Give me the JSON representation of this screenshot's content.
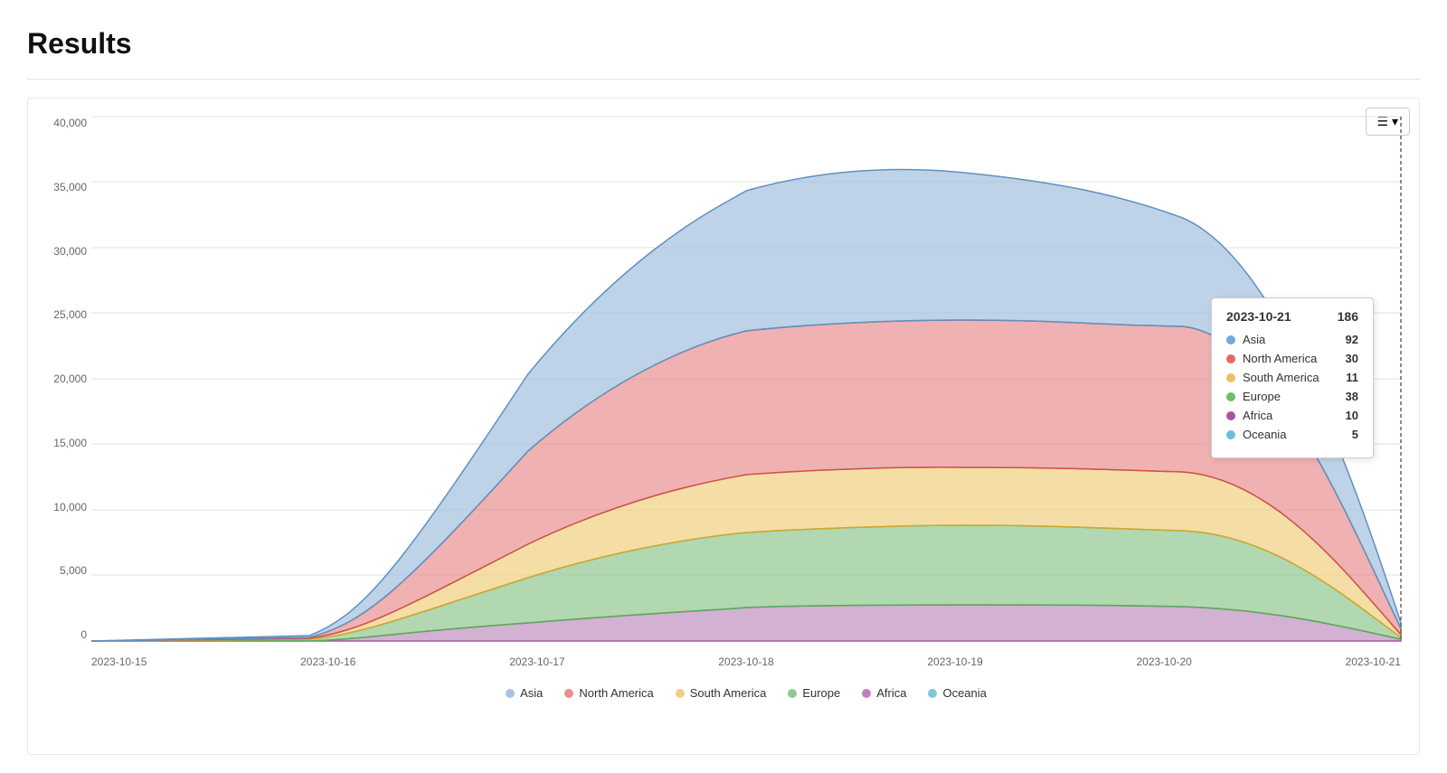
{
  "page": {
    "title": "Results"
  },
  "chart": {
    "menu_label": "☰ ▾",
    "y_axis_labels": [
      "0",
      "5,000",
      "10,000",
      "15,000",
      "20,000",
      "25,000",
      "30,000",
      "35,000",
      "40,000"
    ],
    "x_axis_labels": [
      "2023-10-15",
      "2023-10-16",
      "2023-10-17",
      "2023-10-18",
      "2023-10-19",
      "2023-10-20",
      "2023-10-21"
    ]
  },
  "tooltip": {
    "date": "2023-10-21",
    "total": "186",
    "rows": [
      {
        "region": "Asia",
        "color": "#6fa8dc",
        "value": "92"
      },
      {
        "region": "North America",
        "color": "#e06c5c",
        "value": "30"
      },
      {
        "region": "South America",
        "color": "#f0c060",
        "value": "11"
      },
      {
        "region": "Europe",
        "color": "#6abf69",
        "value": "38"
      },
      {
        "region": "Africa",
        "color": "#a855a0",
        "value": "10"
      },
      {
        "region": "Oceania",
        "color": "#6bbfd9",
        "value": "5"
      }
    ]
  },
  "legend": {
    "items": [
      {
        "label": "Asia",
        "color": "#a8c4e0"
      },
      {
        "label": "North America",
        "color": "#e89090"
      },
      {
        "label": "South America",
        "color": "#f0d080"
      },
      {
        "label": "Europe",
        "color": "#90c890"
      },
      {
        "label": "Africa",
        "color": "#c080c0"
      },
      {
        "label": "Oceania",
        "color": "#80c8d8"
      }
    ]
  }
}
